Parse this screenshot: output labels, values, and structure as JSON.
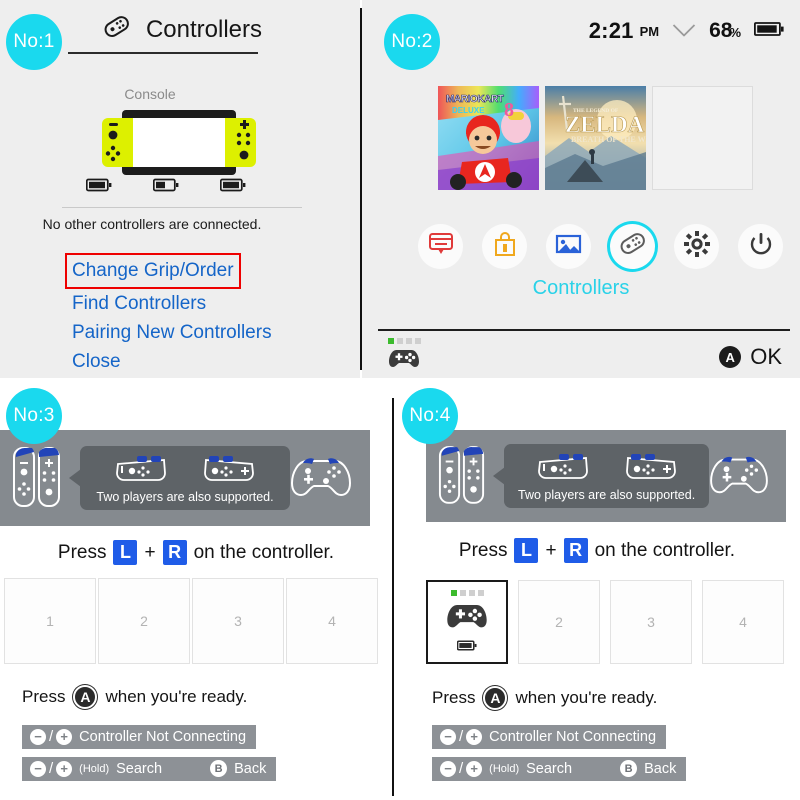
{
  "badges": {
    "one": "No:1",
    "two": "No:2",
    "three": "No:3",
    "four": "No:4",
    "color": "#1ad9ee"
  },
  "panel1": {
    "title": "Controllers",
    "title_icon": "joycon-icon",
    "console_label": "Console",
    "console_art_name": "switch-console-illustration",
    "batteries": [
      "battery-icon",
      "battery-icon",
      "battery-icon"
    ],
    "note": "No other controllers are connected.",
    "links": [
      {
        "label": "Change Grip/Order",
        "highlighted": true
      },
      {
        "label": "Find Controllers",
        "highlighted": false
      },
      {
        "label": "Pairing New Controllers",
        "highlighted": false
      },
      {
        "label": "Close",
        "highlighted": false
      }
    ],
    "highlight_color": "#ee0000",
    "link_color": "#1565c8"
  },
  "panel2": {
    "status": {
      "time": "2:21",
      "ampm": "PM",
      "wifi_icon": "wifi-icon",
      "battery_percent": "68",
      "percent_symbol": "%",
      "battery_icon": "battery-icon"
    },
    "games": [
      {
        "title": "Mario Kart 8 Deluxe",
        "empty": false
      },
      {
        "title": "The Legend of Zelda: Breath of the Wild",
        "empty": false
      },
      {
        "title": "",
        "empty": true
      }
    ],
    "icons": [
      {
        "name": "news-icon",
        "label": "News",
        "color": "#e03a3a",
        "selected": false
      },
      {
        "name": "eshop-icon",
        "label": "Nintendo eShop",
        "color": "#f0a81e",
        "selected": false
      },
      {
        "name": "album-icon",
        "label": "Album",
        "color": "#2a62d8",
        "selected": false
      },
      {
        "name": "controllers-icon",
        "label": "Controllers",
        "color": "#6b6b6b",
        "selected": true
      },
      {
        "name": "settings-icon",
        "label": "System Settings",
        "color": "#3a3a3a",
        "selected": false
      },
      {
        "name": "power-icon",
        "label": "Sleep Mode",
        "color": "#3a3a3a",
        "selected": false
      }
    ],
    "selected_label": "Controllers",
    "selected_color": "#2ad2e8",
    "footer": {
      "controller_icon": "gamepad-icon",
      "player_led": "player-1-led",
      "a_button": "A",
      "ok_label": "OK"
    }
  },
  "panel3": {
    "banner": {
      "left_icon": "joycon-pair-icon",
      "right_icon": "pro-controller-icon",
      "grip_icons": [
        "joycon-horizontal-left-icon",
        "joycon-horizontal-right-icon"
      ],
      "caption": "Two players are also supported."
    },
    "press_lr": {
      "prefix": "Press",
      "key_l": "L",
      "plus": "+",
      "key_r": "R",
      "suffix": "on the controller."
    },
    "slots": [
      {
        "number": "1",
        "filled": false
      },
      {
        "number": "2",
        "filled": false
      },
      {
        "number": "3",
        "filled": false
      },
      {
        "number": "4",
        "filled": false
      }
    ],
    "press_a": {
      "prefix": "Press",
      "button": "A",
      "suffix": "when you're ready."
    },
    "hints": [
      {
        "minus": "−",
        "slash": "/",
        "plus": "+",
        "hold": "",
        "label": "Controller Not Connecting",
        "b_button": "",
        "b_label": ""
      },
      {
        "minus": "−",
        "slash": "/",
        "plus": "+",
        "hold": "(Hold)",
        "label": "Search",
        "b_button": "B",
        "b_label": "Back"
      }
    ]
  },
  "panel4": {
    "banner": {
      "left_icon": "joycon-pair-icon",
      "right_icon": "pro-controller-icon",
      "grip_icons": [
        "joycon-horizontal-left-icon",
        "joycon-horizontal-right-icon"
      ],
      "caption": "Two players are also supported."
    },
    "press_lr": {
      "prefix": "Press",
      "key_l": "L",
      "plus": "+",
      "key_r": "R",
      "suffix": "on the controller."
    },
    "slots": [
      {
        "number": "",
        "filled": true,
        "icon": "gamepad-icon",
        "led": "player-1-led",
        "battery": "battery-icon"
      },
      {
        "number": "2",
        "filled": false
      },
      {
        "number": "3",
        "filled": false
      },
      {
        "number": "4",
        "filled": false
      }
    ],
    "press_a": {
      "prefix": "Press",
      "button": "A",
      "suffix": "when you're ready."
    },
    "hints": [
      {
        "minus": "−",
        "slash": "/",
        "plus": "+",
        "hold": "",
        "label": "Controller Not Connecting",
        "b_button": "",
        "b_label": ""
      },
      {
        "minus": "−",
        "slash": "/",
        "plus": "+",
        "hold": "(Hold)",
        "label": "Search",
        "b_button": "B",
        "b_label": "Back"
      }
    ]
  }
}
